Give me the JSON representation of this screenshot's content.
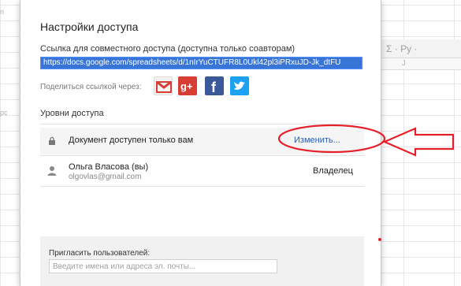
{
  "background": {
    "toolbar_text": "Σ ·  Ру ·",
    "column_letter": "J",
    "left_mark_top": "ri",
    "left_mark_mid": "рс"
  },
  "dialog": {
    "title": "Настройки доступа",
    "link_label": "Ссылка для совместного доступа (доступна только соавторам)",
    "link_value": "https://docs.google.com/spreadsheets/d/1nIrYuCTUFR8L0Ukl42pl3iPRxuJD-Jk_dtFU",
    "share_label": "Поделиться ссылкой через:",
    "share_buttons": [
      "gmail-icon",
      "google-plus-icon",
      "facebook-icon",
      "twitter-icon"
    ],
    "levels_label": "Уровни доступа",
    "access": {
      "text": "Документ доступен только вам",
      "change_label": "Изменить..."
    },
    "user": {
      "name": "Ольга Власова (вы)",
      "email": "olgovlas@gmail.com",
      "role": "Владелец"
    },
    "invite": {
      "label": "Пригласить пользователей:",
      "placeholder": "Введите имена или адреса эл. почты..."
    }
  },
  "colors": {
    "link_highlight": "#3875d7",
    "change_link": "#2a5db0",
    "annotation": "#e4202a"
  }
}
